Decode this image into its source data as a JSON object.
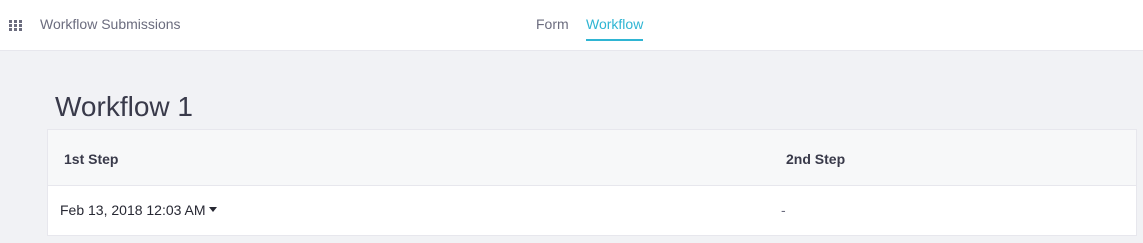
{
  "topbar": {
    "apps_icon": "apps-grid-icon",
    "title": "Workflow Submissions"
  },
  "tabs": [
    {
      "label": "Form",
      "active": false
    },
    {
      "label": "Workflow",
      "active": true
    }
  ],
  "accent_color": "#2fb5d3",
  "main": {
    "title": "Workflow 1",
    "table": {
      "columns": [
        "1st Step",
        "2nd Step"
      ],
      "rows": [
        {
          "step1": "Feb 13, 2018 12:03 AM",
          "step1_icon": "caret-down-icon",
          "step2": "-"
        }
      ]
    }
  }
}
